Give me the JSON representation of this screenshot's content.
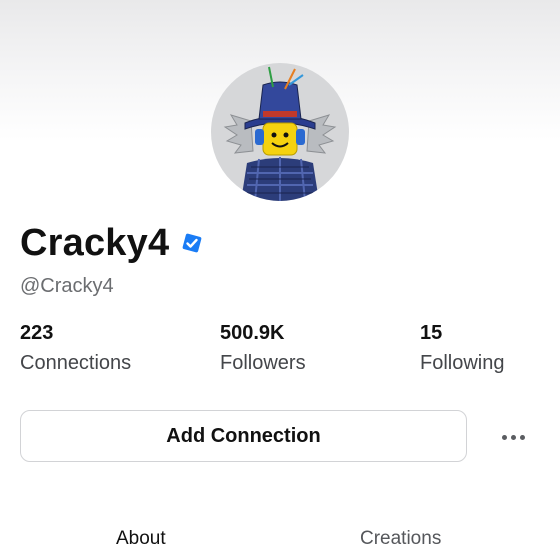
{
  "profile": {
    "display_name": "Cracky4",
    "username": "@Cracky4",
    "verified": true,
    "avatar_icon": "roblox-avatar-image"
  },
  "stats": [
    {
      "value": "223",
      "label": "Connections"
    },
    {
      "value": "500.9K",
      "label": "Followers"
    },
    {
      "value": "15",
      "label": "Following"
    }
  ],
  "actions": {
    "add_connection_label": "Add Connection",
    "more_icon": "more-horizontal-icon"
  },
  "tabs": [
    {
      "label": "About",
      "active": true
    },
    {
      "label": "Creations",
      "active": false
    }
  ],
  "colors": {
    "verified_blue": "#1a7cf5",
    "text_primary": "#111111",
    "text_secondary": "#6b6d70"
  }
}
